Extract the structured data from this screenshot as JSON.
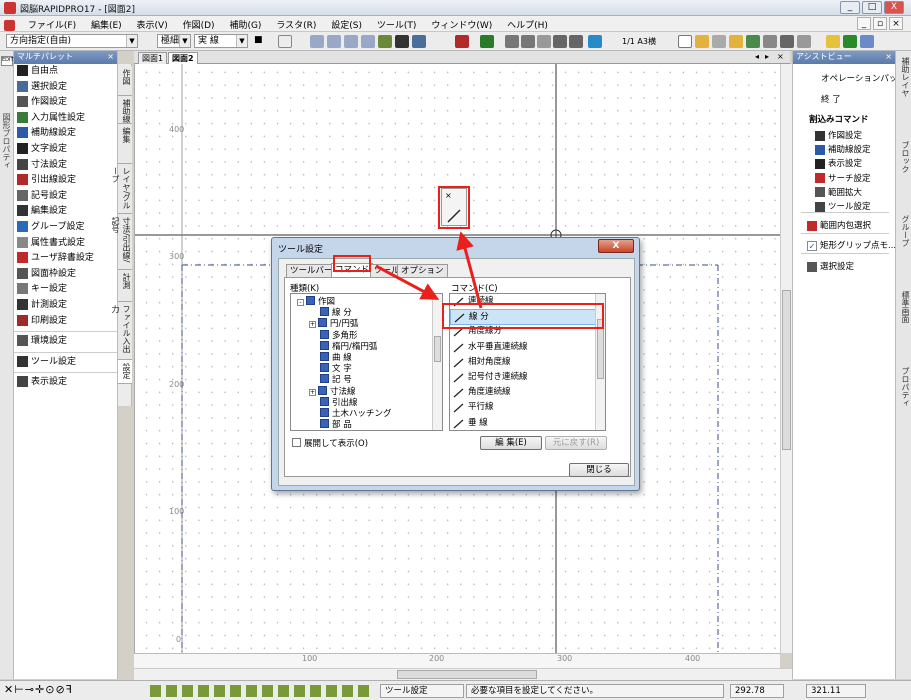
{
  "window": {
    "title": "図脳RAPIDPRO17 - [図面2]",
    "min": "_",
    "max": "□",
    "close": "X"
  },
  "menu": [
    "ファイル(F)",
    "編集(E)",
    "表示(V)",
    "作図(D)",
    "補助(G)",
    "ラスタ(R)",
    "設定(S)",
    "ツール(T)",
    "ウィンドウ(W)",
    "ヘルプ(H)"
  ],
  "toolbar": {
    "direction": "方向指定(自由)",
    "line_width": "極細",
    "line_type": "実 線",
    "color": "■",
    "paper": "1/1 A3横"
  },
  "left_palette": {
    "strip_label": "図形プロパティ",
    "title": "マルチパレット",
    "items": [
      {
        "label": "自由点",
        "icon": "free-point-icon"
      },
      {
        "label": "選択設定",
        "icon": "select-settings-icon"
      },
      {
        "label": "作図設定",
        "icon": "draw-settings-icon"
      },
      {
        "label": "入力属性設定",
        "icon": "input-attr-icon"
      },
      {
        "label": "補助線設定",
        "icon": "guide-line-icon"
      },
      {
        "label": "文字設定",
        "icon": "text-settings-icon"
      },
      {
        "label": "寸法設定",
        "icon": "dimension-icon"
      },
      {
        "label": "引出線設定",
        "icon": "leader-icon"
      },
      {
        "label": "記号設定",
        "icon": "symbol-icon"
      },
      {
        "label": "編集設定",
        "icon": "edit-settings-icon"
      },
      {
        "label": "グループ設定",
        "icon": "group-icon"
      },
      {
        "label": "属性書式設定",
        "icon": "attr-format-icon"
      },
      {
        "label": "ユーザ辞書設定",
        "icon": "user-dict-icon"
      },
      {
        "label": "図面枠設定",
        "icon": "frame-icon"
      },
      {
        "label": "キー設定",
        "icon": "key-icon"
      },
      {
        "label": "計測設定",
        "icon": "measure-icon"
      },
      {
        "label": "印刷設定",
        "icon": "print-icon"
      }
    ],
    "group2": [
      {
        "label": "環境設定",
        "icon": "environment-icon"
      },
      {
        "label": "ツール設定",
        "icon": "tool-settings-icon"
      },
      {
        "label": "表示設定",
        "icon": "display-settings-icon"
      }
    ],
    "vtabs": [
      "作図",
      "補助線",
      "編集",
      "レイヤ/グループ",
      "寸法/引出線/記号",
      "計測",
      "ファイル入出力",
      "設定"
    ]
  },
  "doc_tabs": [
    "図面1",
    "図面2"
  ],
  "ruler": {
    "h": [
      "100",
      "200",
      "300",
      "400"
    ],
    "v": [
      "400",
      "300",
      "200",
      "100",
      "0"
    ]
  },
  "assist": {
    "title": "アシストビュー",
    "items": [
      "オペレーションパッ...",
      "終 了"
    ],
    "interrupt_title": "割込みコマンド",
    "interrupt": [
      {
        "label": "作図設定",
        "icon": "draw-settings-icon"
      },
      {
        "label": "補助線設定",
        "icon": "guide-line-icon"
      },
      {
        "label": "表示設定",
        "icon": "display-settings-icon"
      },
      {
        "label": "サーチ設定",
        "icon": "search-icon"
      },
      {
        "label": "範囲拡大",
        "icon": "zoom-range-icon"
      },
      {
        "label": "ツール設定",
        "icon": "tool-settings-icon"
      }
    ],
    "range_select": "範囲内包選択",
    "rect_grip": "矩形グリップ点モ...",
    "select_settings": "選択設定"
  },
  "right_tabs": [
    "補助レイヤ",
    "ブロック",
    "グループ",
    "標準画面",
    "プロパティ"
  ],
  "dialog": {
    "title": "ツール設定",
    "close": "X",
    "tabs": [
      "ツールバー",
      "コマンド",
      "ツール",
      "オプション"
    ],
    "type_label": "種類(K)",
    "cmd_label": "コマンド(C)",
    "tree": [
      {
        "label": "作図",
        "level": 0,
        "exp": "-"
      },
      {
        "label": "線 分",
        "level": 1,
        "exp": ""
      },
      {
        "label": "円/円弧",
        "level": 1,
        "exp": "+"
      },
      {
        "label": "多角形",
        "level": 1,
        "exp": ""
      },
      {
        "label": "楕円/楕円弧",
        "level": 1,
        "exp": ""
      },
      {
        "label": "曲 線",
        "level": 1,
        "exp": ""
      },
      {
        "label": "文 字",
        "level": 1,
        "exp": ""
      },
      {
        "label": "記 号",
        "level": 1,
        "exp": ""
      },
      {
        "label": "寸法線",
        "level": 1,
        "exp": "+"
      },
      {
        "label": "引出線",
        "level": 1,
        "exp": ""
      },
      {
        "label": "土木ハッチング",
        "level": 1,
        "exp": ""
      },
      {
        "label": "部 品",
        "level": 1,
        "exp": ""
      }
    ],
    "commands": [
      "連続線",
      "線 分",
      "角度線分",
      "水平垂直連続線",
      "相対角度線",
      "記号付き連続線",
      "角度連続線",
      "平行線",
      "垂 線"
    ],
    "expand_label": "展開して表示(O)",
    "edit_button": "編 集(E)",
    "revert_button": "元に戻す(R)",
    "close_button": "閉じる"
  },
  "popup": {
    "close": "×"
  },
  "status": {
    "tool": "ツール設定",
    "message": "必要な項目を設定してください。",
    "x": "292.78",
    "y": "321.11"
  },
  "colors": {
    "accent": "#e8211c",
    "selection": "#cce4f7",
    "title_gradient": "#5a7aa8"
  }
}
